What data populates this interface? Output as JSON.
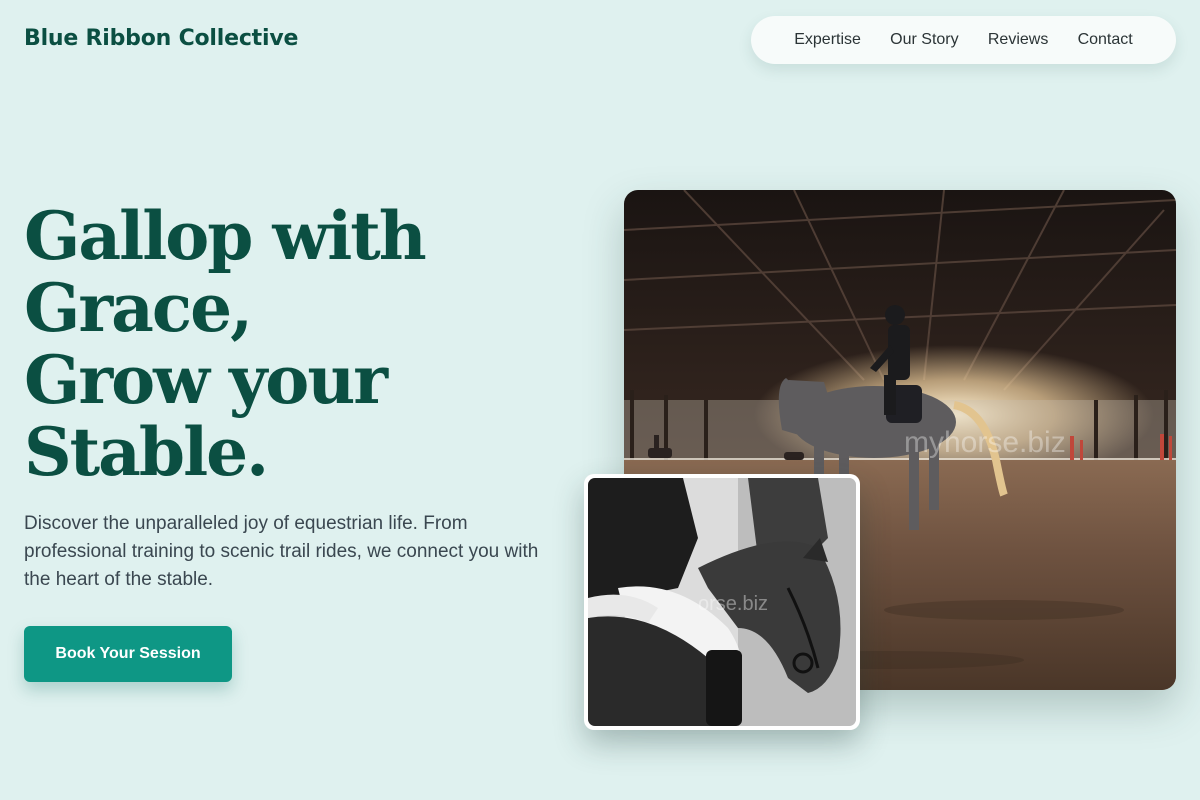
{
  "header": {
    "brand": "Blue Ribbon Collective",
    "nav": [
      {
        "label": "Expertise"
      },
      {
        "label": "Our Story"
      },
      {
        "label": "Reviews"
      },
      {
        "label": "Contact"
      }
    ]
  },
  "hero": {
    "headline_lines": [
      "Gallop with",
      "Grace,",
      "Grow your",
      "Stable."
    ],
    "lead": "Discover the unparalleled joy of equestrian life. From professional training to scenic trail rides, we connect you with the heart of the stable.",
    "cta_label": "Book Your Session"
  },
  "images": {
    "main_watermark": "myhorse.biz",
    "inset_watermark": "orse.biz"
  },
  "colors": {
    "background": "#dff1ef",
    "brand_green": "#0b4f42",
    "accent_teal": "#0e9785"
  }
}
